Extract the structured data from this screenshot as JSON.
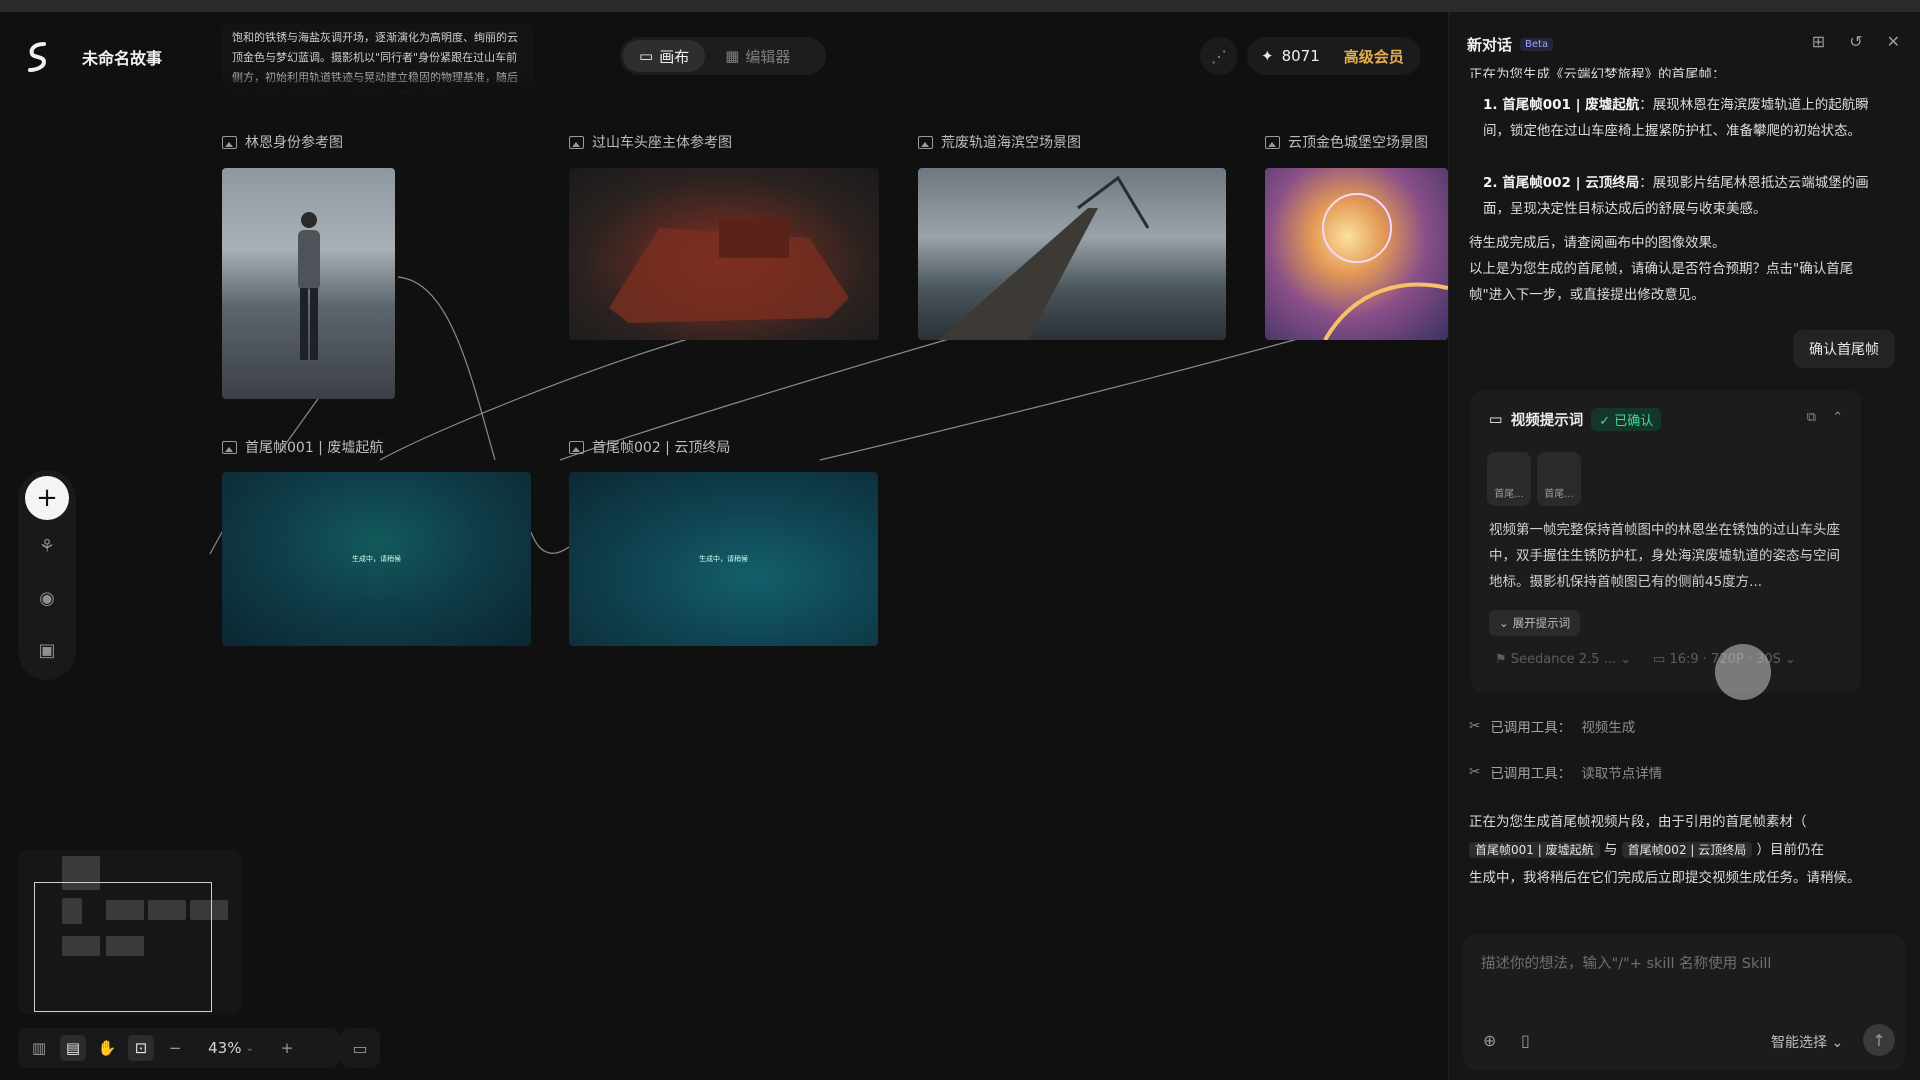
{
  "header": {
    "title": "未命名故事",
    "story_excerpt": "饱和的铁锈与海盐灰调开场，逐渐演化为高明度、绚丽的云顶金色与梦幻蓝调。摄影机以\"同行者\"身份紧跟在过山车前侧方，初始利用轨道铁迹与晃动建立稳固的物理基准，随后通过流畅的纵深推进（中景变动）展现空间的",
    "tabs": [
      {
        "label": "画布"
      },
      {
        "label": "编辑器"
      }
    ],
    "credits": "8071",
    "vip_label": "高级会员"
  },
  "nodes": {
    "ref1_label": "林恩身份参考图",
    "ref2_label": "过山车头座主体参考图",
    "ref3_label": "荒废轨道海滨空场景图",
    "ref4_label": "云顶金色城堡空场景图",
    "frame1_label": "首尾帧001 | 废墟起航",
    "frame2_label": "首尾帧002 | 云顶终局",
    "generating_text": "生成中，请稍候"
  },
  "toolbar": {
    "zoom": "43%"
  },
  "panel": {
    "title": "新对话",
    "beta": "Beta",
    "intro_line": "正在为您生成《云端幻梦旅程》的首尾帧：",
    "list": [
      {
        "head": "1. 首尾帧001 | 废墟起航",
        "text": "：展现林恩在海滨废墟轨道上的起航瞬间，锁定他在过山车座椅上握紧防护杠、准备攀爬的初始状态。"
      },
      {
        "head": "2. 首尾帧002 | 云顶终局",
        "text": "：展现影片结尾林恩抵达云端城堡的画面，呈现决定性目标达成后的舒展与收束美感。"
      }
    ],
    "after_list": "待生成完成后，请查阅画布中的图像效果。",
    "ask_confirm": "以上是为您生成的首尾帧，请确认是否符合预期？点击\"确认首尾帧\"进入下一步，或直接提出修改意见。",
    "confirm_button": "确认首尾帧",
    "card": {
      "title": "视频提示词",
      "status": "已确认",
      "thumb1": "首尾...",
      "thumb2": "首尾...",
      "body": "视频第一帧完整保持首帧图中的林恩坐在锈蚀的过山车头座中，双手握住生锈防护杠，身处海滨废墟轨道的姿态与空间地标。摄影机保持首帧图已有的侧前45度方...",
      "expand": "展开提示词",
      "model": "Seedance 2.5 ...",
      "params": "16:9 · 720P · 30S"
    },
    "tool1_label": "已调用工具：",
    "tool1_name": "视频生成",
    "tool2_label": "已调用工具：",
    "tool2_name": "读取节点详情",
    "final_pre": "正在为您生成首尾帧视频片段，由于引用的首尾帧素材（",
    "chip1": "首尾帧001 | 废墟起航",
    "conj": "与",
    "chip2": "首尾帧002 | 云顶终局",
    "final_mid": "）目前仍在",
    "final_post": "生成中，我将稍后在它们完成后立即提交视频生成任务。请稍候。",
    "composer_placeholder": "描述你的想法，输入\"/\"+ skill 名称使用 Skill",
    "smart_select": "智能选择"
  }
}
